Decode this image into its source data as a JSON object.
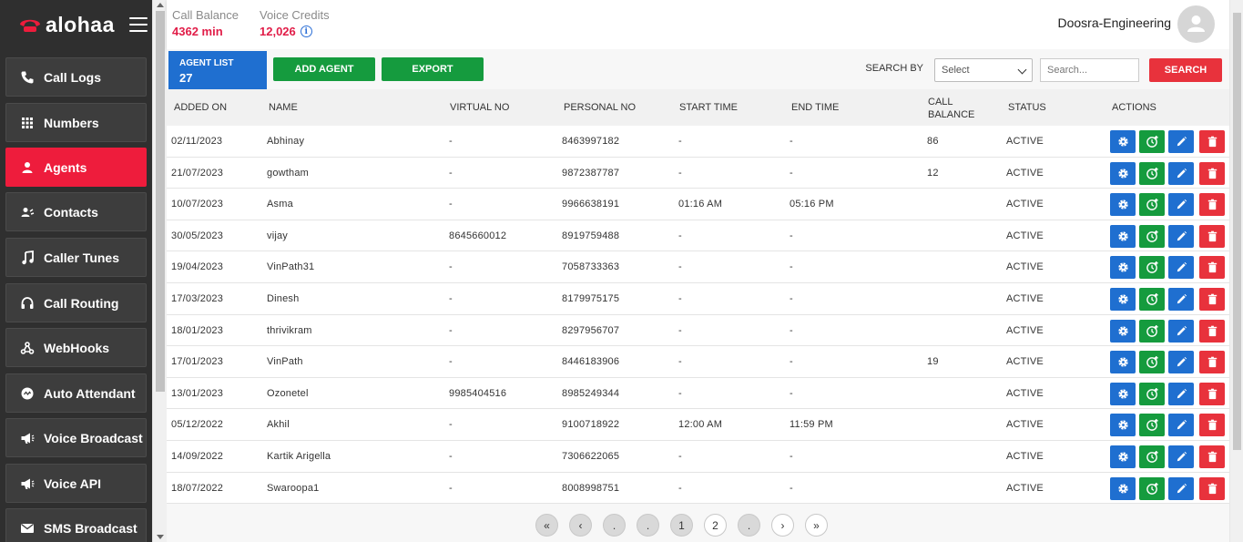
{
  "brand": {
    "name": "alohaa",
    "accent": "#ee1c3c"
  },
  "sidebar": {
    "items": [
      {
        "label": "Call Logs",
        "icon": "phone-icon"
      },
      {
        "label": "Numbers",
        "icon": "grid-icon"
      },
      {
        "label": "Agents",
        "icon": "user-icon",
        "active": true
      },
      {
        "label": "Contacts",
        "icon": "contacts-icon"
      },
      {
        "label": "Caller Tunes",
        "icon": "music-icon"
      },
      {
        "label": "Call Routing",
        "icon": "headset-icon"
      },
      {
        "label": "WebHooks",
        "icon": "webhook-icon"
      },
      {
        "label": "Auto Attendant",
        "icon": "voicemail-icon"
      },
      {
        "label": "Voice Broadcast",
        "icon": "megaphone-icon"
      },
      {
        "label": "Voice API",
        "icon": "megaphone-icon"
      },
      {
        "label": "SMS Broadcast",
        "icon": "mail-icon"
      }
    ]
  },
  "header": {
    "call_balance_label": "Call Balance",
    "call_balance_value": "4362 min",
    "voice_credits_label": "Voice Credits",
    "voice_credits_value": "12,026",
    "user_name": "Doosra-Engineering"
  },
  "toolbar": {
    "agent_list_label": "AGENT LIST",
    "agent_count": "27",
    "add_agent_label": "ADD AGENT",
    "export_label": "EXPORT",
    "search_by_label": "SEARCH BY",
    "select_value": "Select",
    "search_placeholder": "Search...",
    "search_button_label": "SEARCH"
  },
  "table": {
    "headers": [
      "ADDED ON",
      "NAME",
      "VIRTUAL NO",
      "PERSONAL NO",
      "START TIME",
      "END TIME",
      "CALL\nBALANCE",
      "STATUS",
      "ACTIONS"
    ],
    "rows": [
      [
        "02/11/2023",
        "Abhinay",
        "-",
        "8463997182",
        "-",
        "-",
        "86",
        "ACTIVE"
      ],
      [
        "21/07/2023",
        "gowtham",
        "-",
        "9872387787",
        "-",
        "-",
        "12",
        "ACTIVE"
      ],
      [
        "10/07/2023",
        "Asma",
        "-",
        "9966638191",
        "01:16 AM",
        "05:16 PM",
        "",
        "ACTIVE"
      ],
      [
        "30/05/2023",
        "vijay",
        "8645660012",
        "8919759488",
        "-",
        "-",
        "",
        "ACTIVE"
      ],
      [
        "19/04/2023",
        "VinPath31",
        "-",
        "7058733363",
        "-",
        "-",
        "",
        "ACTIVE"
      ],
      [
        "17/03/2023",
        "Dinesh",
        "-",
        "8179975175",
        "-",
        "-",
        "",
        "ACTIVE"
      ],
      [
        "18/01/2023",
        "thrivikram",
        "-",
        "8297956707",
        "-",
        "-",
        "",
        "ACTIVE"
      ],
      [
        "17/01/2023",
        "VinPath",
        "-",
        "8446183906",
        "-",
        "-",
        "19",
        "ACTIVE"
      ],
      [
        "13/01/2023",
        "Ozonetel",
        "9985404516",
        "8985249344",
        "-",
        "-",
        "",
        "ACTIVE"
      ],
      [
        "05/12/2022",
        "Akhil",
        "-",
        "9100718922",
        "12:00 AM",
        "11:59 PM",
        "",
        "ACTIVE"
      ],
      [
        "14/09/2022",
        "Kartik Arigella",
        "-",
        "7306622065",
        "-",
        "-",
        "",
        "ACTIVE"
      ],
      [
        "18/07/2022",
        "Swaroopa1",
        "-",
        "8008998751",
        "-",
        "-",
        "",
        "ACTIVE"
      ]
    ]
  },
  "pagination": [
    "«",
    "‹",
    ".",
    ".",
    "1",
    "2",
    ".",
    "›",
    "»"
  ]
}
